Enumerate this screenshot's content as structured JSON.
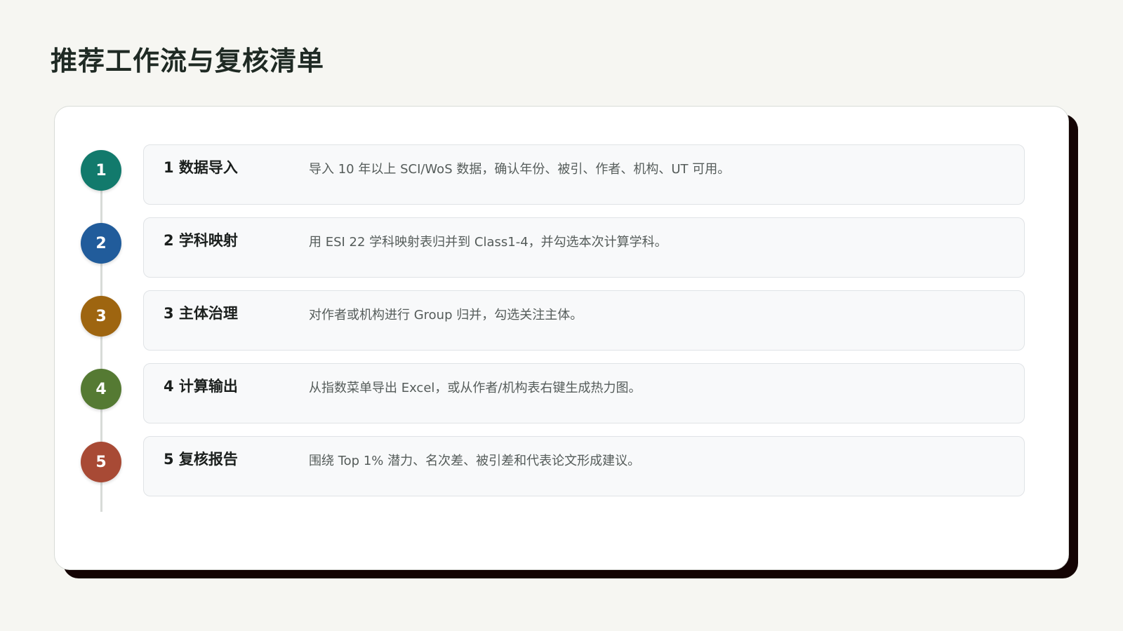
{
  "page": {
    "title": "推荐工作流与复核清单"
  },
  "steps": [
    {
      "number": "1",
      "title": "1 数据导入",
      "description": "导入 10 年以上 SCI/WoS 数据，确认年份、被引、作者、机构、UT 可用。",
      "color": "#127a6c"
    },
    {
      "number": "2",
      "title": "2 学科映射",
      "description": "用 ESI 22 学科映射表归并到 Class1-4，并勾选本次计算学科。",
      "color": "#215c9b"
    },
    {
      "number": "3",
      "title": "3 主体治理",
      "description": "对作者或机构进行 Group 归并，勾选关注主体。",
      "color": "#9e6510"
    },
    {
      "number": "4",
      "title": "4 计算输出",
      "description": "从指数菜单导出 Excel，或从作者/机构表右键生成热力图。",
      "color": "#557a33"
    },
    {
      "number": "5",
      "title": "5 复核报告",
      "description": "围绕 Top 1% 潜力、名次差、被引差和代表论文形成建议。",
      "color": "#a84a35"
    }
  ]
}
